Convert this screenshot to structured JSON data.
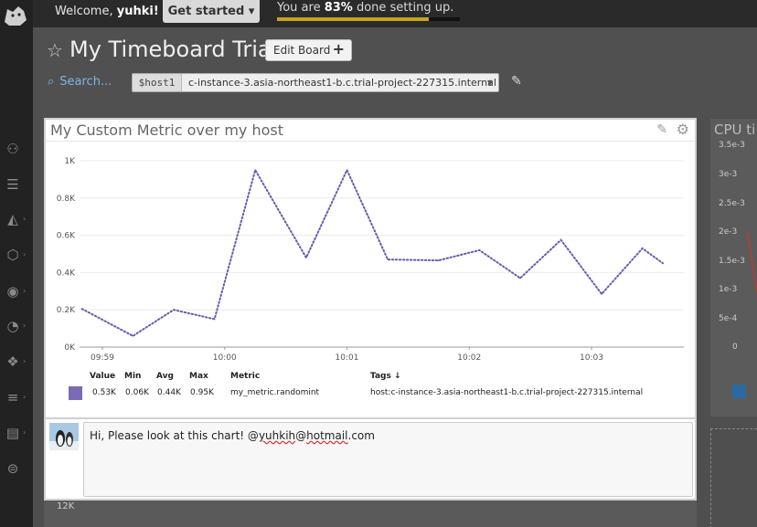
{
  "topbar": {
    "welcome_prefix": "Welcome, ",
    "username": "yuhki!",
    "get_started": "Get started ▾",
    "setup_prefix": "You are ",
    "setup_percent": "83%",
    "setup_suffix": " done setting up.",
    "setup_progress": 0.83
  },
  "header": {
    "title": "My Timeboard Trial",
    "edit_board": "Edit Board",
    "search": "Search...",
    "template_var": {
      "name": "$host1",
      "value": "c-instance-3.asia-northeast1-b.c.trial-project-227315.internal"
    }
  },
  "widget": {
    "title": "My Custom Metric over my host",
    "legend": {
      "headers": [
        "Value",
        "Min",
        "Avg",
        "Max",
        "Metric",
        "Tags ↓"
      ],
      "row": {
        "color": "#7b6ab5",
        "value": "0.53K",
        "min": "0.06K",
        "avg": "0.44K",
        "max": "0.95K",
        "metric": "my_metric.randomint",
        "tags": "host:c-instance-3.asia-northeast1-b.c.trial-project-227315.internal"
      }
    }
  },
  "chart_data": {
    "type": "line",
    "title": "My Custom Metric over my host",
    "x_tick_labels": [
      "09:59",
      "10:00",
      "10:01",
      "10:02",
      "10:03"
    ],
    "y_tick_labels": [
      "0K",
      "0.2K",
      "0.4K",
      "0.6K",
      "0.8K",
      "1K"
    ],
    "ylim": [
      0,
      1000
    ],
    "grid": true,
    "series": [
      {
        "name": "my_metric.randomint",
        "color": "#6a5bb0",
        "style": "dotted",
        "x": [
          "09:58:50",
          "09:59:15",
          "09:59:35",
          "09:59:55",
          "10:00:15",
          "10:00:40",
          "10:01:00",
          "10:01:20",
          "10:01:45",
          "10:02:05",
          "10:02:25",
          "10:02:45",
          "10:03:05",
          "10:03:25",
          "10:03:35"
        ],
        "values": [
          205,
          60,
          200,
          150,
          950,
          480,
          950,
          470,
          465,
          520,
          370,
          575,
          285,
          530,
          450
        ]
      }
    ]
  },
  "comment": {
    "text_prefix": "Hi, Please look at this chart! @",
    "text_user": "yuhkih",
    "text_mid": "@",
    "text_domain": "hotmail",
    "text_suffix": ".com"
  },
  "background": {
    "cpu_title": "CPU ti",
    "cpu_ticks": [
      "3.5e-3",
      "3e-3",
      "2.5e-3",
      "2e-3",
      "1.5e-3",
      "1e-3",
      "5e-4",
      "0"
    ],
    "left_tick": "12K"
  },
  "colors": {
    "accent_progress": "#c7a41e",
    "series": "#6a5bb0",
    "link": "#7fb3e6"
  }
}
